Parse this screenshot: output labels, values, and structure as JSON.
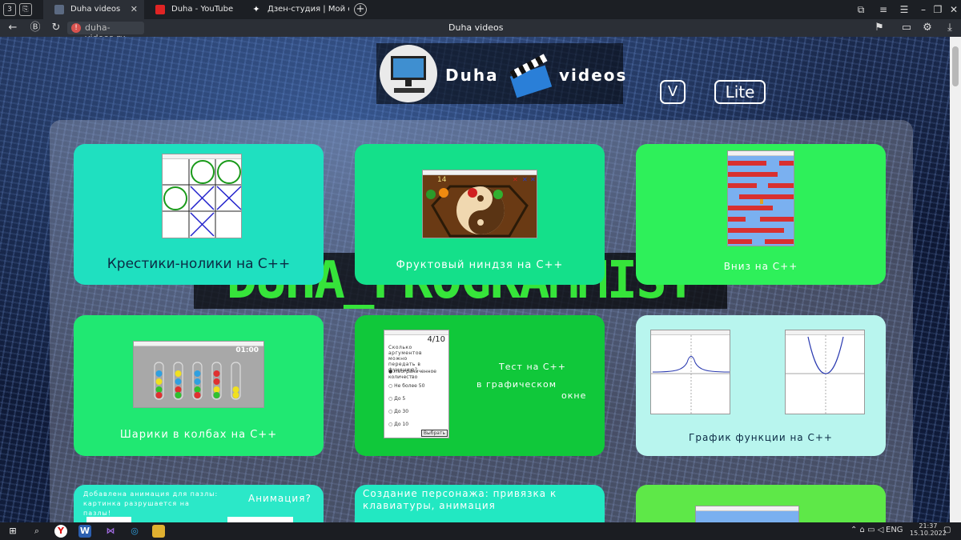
{
  "browser": {
    "tabs": [
      {
        "label": "Duha videos",
        "active": true
      },
      {
        "label": "Duha - YouTube",
        "active": false
      },
      {
        "label": "Дзен-студия | Мой сайт Du",
        "active": false
      }
    ],
    "new_tab": "+",
    "back": "←",
    "reload": "↻",
    "url": "duha-videos.ru",
    "page_title": "Duha videos"
  },
  "header": {
    "logo_left": "Duha",
    "logo_right": "videos",
    "v_button": "V",
    "lite_button": "Lite"
  },
  "banner_text": "DUHA_PROGRAMMIST",
  "cards": [
    {
      "title": "Крестики-нолики на С++",
      "color": "#1fe0c0"
    },
    {
      "title": "Фруктовый ниндзя на С++",
      "color": "#14e08a",
      "score": "14"
    },
    {
      "title": "Вниз на С++",
      "color": "#2ef05a"
    },
    {
      "title": "Шарики в колбах на С++",
      "color": "#20e872",
      "timer": "01:00"
    },
    {
      "title": "Тест на С++",
      "subtitle_1": "в графическом",
      "subtitle_2": "окне",
      "color": "#10c83a",
      "quiz": {
        "counter": "4/10",
        "question": "Сколько аргументов можно передать в функцию?",
        "options": [
          "Неограниченное количество",
          "Не более 50",
          "До 5",
          "До 30",
          "До 10"
        ],
        "button": "Выбрать"
      }
    },
    {
      "title": "График функции на С++",
      "color": "#b8f5ee"
    },
    {
      "title": "Добавлена анимация для пазлы: картинка разрушается на пазлы!",
      "extra": "Анимация?",
      "color": "#2be8c8"
    },
    {
      "title": "Создание персонажа: привязка к клавиатуры, анимация",
      "color": "#22e8c2"
    },
    {
      "title": "",
      "color": "#5ee848"
    }
  ],
  "taskbar": {
    "lang": "ENG",
    "time": "21:37",
    "date": "15.10.2022"
  }
}
